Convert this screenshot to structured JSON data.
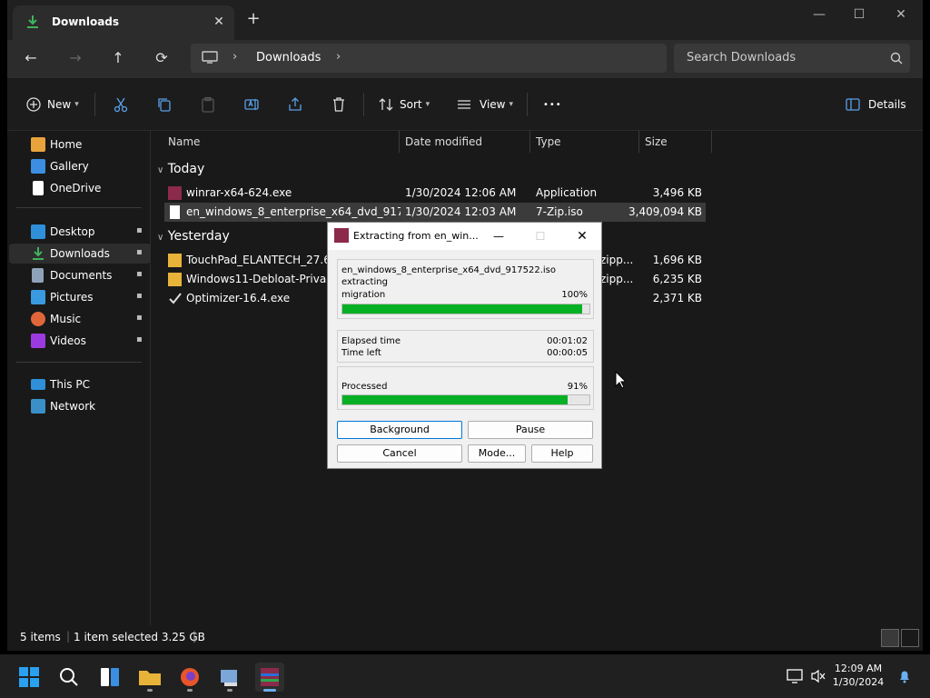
{
  "window": {
    "tab_title": "Downloads",
    "tab_close": "✕",
    "new_tab": "+",
    "controls": {
      "minimize": "—",
      "maximize": "☐",
      "close": "✕"
    }
  },
  "navbar": {
    "back": "←",
    "forward": "→",
    "up": "↑",
    "refresh": "⟳",
    "chevron": "›",
    "location": "Downloads",
    "search_placeholder": "Search Downloads"
  },
  "commandbar": {
    "new_label": "New",
    "sort_label": "Sort",
    "view_label": "View",
    "more_label": "•••",
    "details_label": "Details"
  },
  "sidebar": {
    "quick": [
      {
        "label": "Home",
        "icon": "home-icon",
        "color": "#e8a33d"
      },
      {
        "label": "Gallery",
        "icon": "gallery-icon",
        "color": "#3b8ee0"
      },
      {
        "label": "OneDrive",
        "icon": "file-icon",
        "color": "#ffffff"
      }
    ],
    "pinned": [
      {
        "label": "Desktop",
        "icon": "desktop-icon",
        "color": "#2f8fd8"
      },
      {
        "label": "Downloads",
        "icon": "download-icon",
        "color": "#3fb25c"
      },
      {
        "label": "Documents",
        "icon": "documents-icon",
        "color": "#8fa3b8"
      },
      {
        "label": "Pictures",
        "icon": "pictures-icon",
        "color": "#3a9ae0"
      },
      {
        "label": "Music",
        "icon": "music-icon",
        "color": "#e0663a"
      },
      {
        "label": "Videos",
        "icon": "videos-icon",
        "color": "#9a3ae0"
      }
    ],
    "pin_glyph": "📌",
    "this_pc": "This PC",
    "network": "Network"
  },
  "columns": {
    "name": "Name",
    "date": "Date modified",
    "type": "Type",
    "size": "Size"
  },
  "groups": {
    "today": "Today",
    "yesterday": "Yesterday",
    "chevron": "∨"
  },
  "files_today": [
    {
      "name": "winrar-x64-624.exe",
      "date": "1/30/2024 12:06 AM",
      "type": "Application",
      "size": "3,496 KB"
    },
    {
      "name": "en_windows_8_enterprise_x64_dvd_91752...",
      "date": "1/30/2024 12:03 AM",
      "type": "7-Zip.iso",
      "size": "3,409,094 KB"
    }
  ],
  "files_yesterday": [
    {
      "name": "TouchPad_ELANTECH_27.6.1...",
      "type": "zipp...",
      "size": "1,696 KB"
    },
    {
      "name": "Windows11-Debloat-Privacy-...",
      "type": "zipp...",
      "size": "6,235 KB"
    },
    {
      "name": "Optimizer-16.4.exe",
      "type": "",
      "size": "2,371 KB"
    }
  ],
  "status": {
    "items": "5 items",
    "selected": "1 item selected  3.25 GB"
  },
  "dialog": {
    "title": "Extracting from en_win...",
    "archive": "en_windows_8_enterprise_x64_dvd_917522.iso",
    "action": "extracting",
    "current": "migration",
    "current_pct": "100%",
    "current_progress": 0.97,
    "elapsed_label": "Elapsed time",
    "elapsed": "00:01:02",
    "left_label": "Time left",
    "left": "00:00:05",
    "processed_label": "Processed",
    "processed_pct": "91%",
    "processed_progress": 0.91,
    "buttons": {
      "background": "Background",
      "pause": "Pause",
      "cancel": "Cancel",
      "mode": "Mode...",
      "help": "Help"
    }
  },
  "taskbar": {
    "time": "12:09 AM",
    "date": "1/30/2024"
  },
  "colors": {
    "accent": "#0078d7",
    "progress": "#06b025",
    "folder": "#e8b339"
  }
}
